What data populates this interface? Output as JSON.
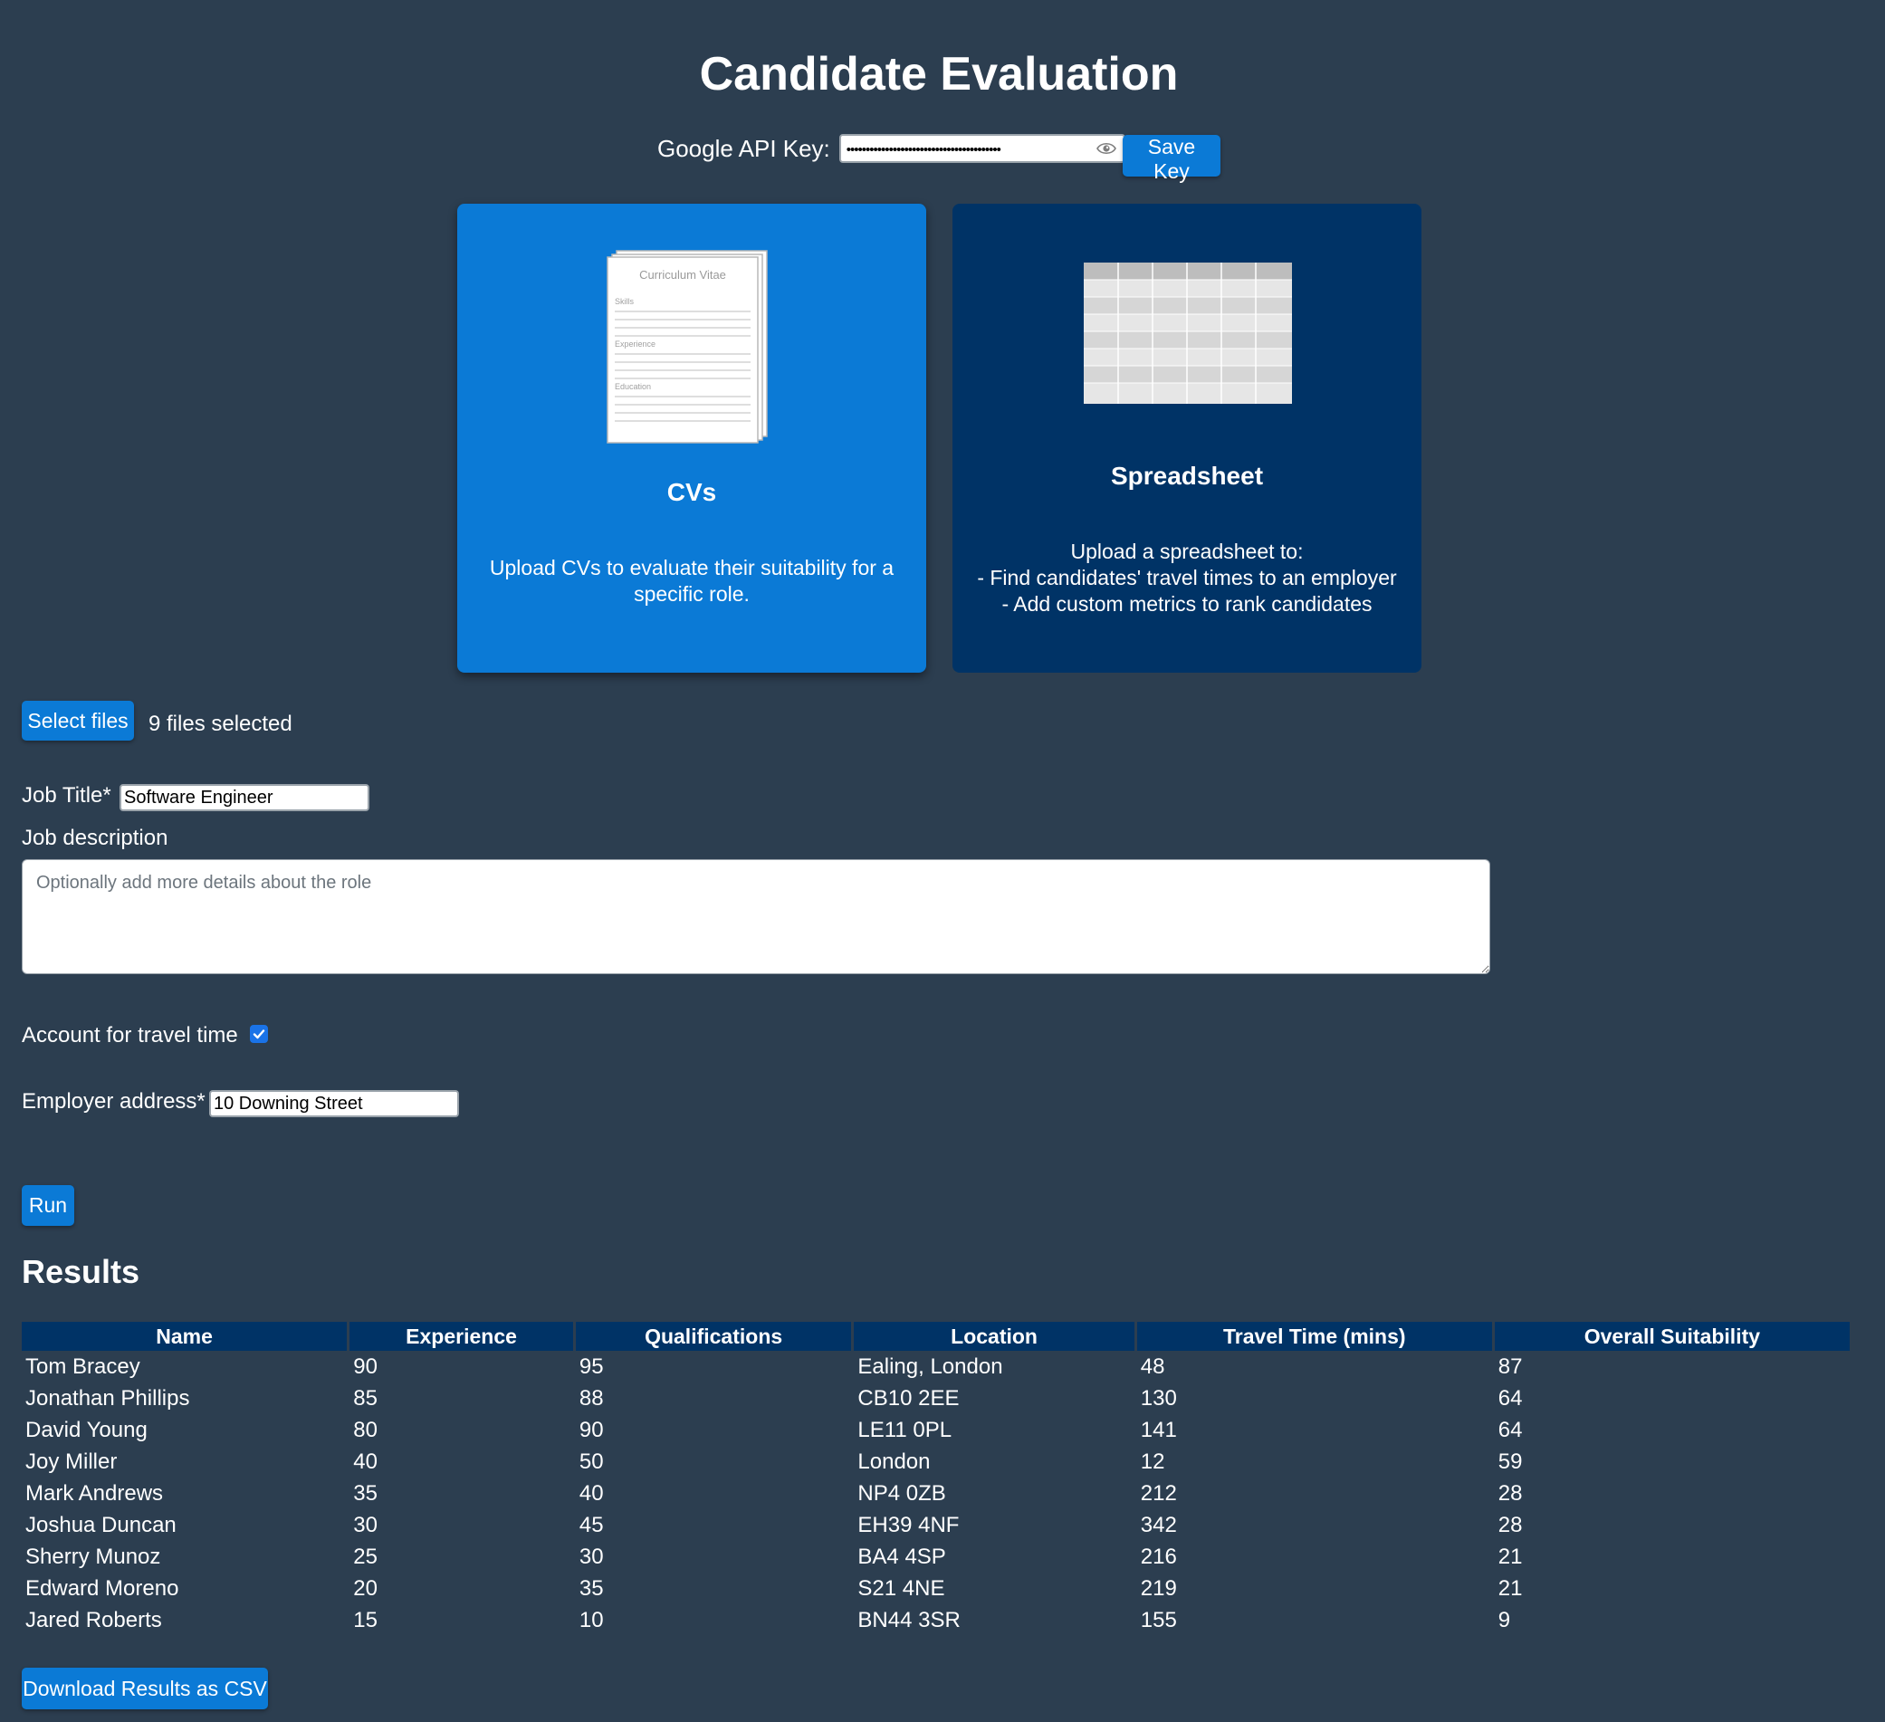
{
  "page": {
    "title": "Candidate Evaluation"
  },
  "api_key": {
    "label": "Google API Key:",
    "masked_value": "••••••••••••••••••••••••••••••••••••••••",
    "save_label": "Save Key",
    "visibility_icon": "eye-icon"
  },
  "cards": {
    "cvs": {
      "title": "CVs",
      "description": "Upload CVs to evaluate their suitability for a specific role.",
      "illustration": {
        "heading": "Curriculum Vitae",
        "sections": [
          "Skills",
          "Experience",
          "Education"
        ]
      },
      "selected": true
    },
    "spreadsheet": {
      "title": "Spreadsheet",
      "description": "Upload a spreadsheet to:\n- Find candidates' travel times to an employer\n- Add custom metrics to rank candidates",
      "selected": false
    }
  },
  "files": {
    "select_label": "Select files",
    "status": "9 files selected"
  },
  "form": {
    "job_title_label": "Job Title*",
    "job_title_value": "Software Engineer",
    "job_description_label": "Job description",
    "job_description_placeholder": "Optionally add more details about the role",
    "travel_time_label": "Account for travel time",
    "travel_time_checked": true,
    "employer_address_label": "Employer address*",
    "employer_address_value": "10 Downing Street",
    "run_label": "Run"
  },
  "results": {
    "heading": "Results",
    "columns": [
      "Name",
      "Experience",
      "Qualifications",
      "Location",
      "Travel Time (mins)",
      "Overall Suitability"
    ],
    "rows": [
      [
        "Tom Bracey",
        "90",
        "95",
        "Ealing, London",
        "48",
        "87"
      ],
      [
        "Jonathan Phillips",
        "85",
        "88",
        "CB10 2EE",
        "130",
        "64"
      ],
      [
        "David Young",
        "80",
        "90",
        "LE11 0PL",
        "141",
        "64"
      ],
      [
        "Joy Miller",
        "40",
        "50",
        "London",
        "12",
        "59"
      ],
      [
        "Mark Andrews",
        "35",
        "40",
        "NP4 0ZB",
        "212",
        "28"
      ],
      [
        "Joshua Duncan",
        "30",
        "45",
        "EH39 4NF",
        "342",
        "28"
      ],
      [
        "Sherry Munoz",
        "25",
        "30",
        "BA4 4SP",
        "216",
        "21"
      ],
      [
        "Edward Moreno",
        "20",
        "35",
        "S21 4NE",
        "219",
        "21"
      ],
      [
        "Jared Roberts",
        "15",
        "10",
        "BN44 3SR",
        "155",
        "9"
      ]
    ],
    "download_label": "Download Results as CSV"
  },
  "colors": {
    "background": "#2c3e50",
    "accent": "#0b7ad6",
    "navy": "#003366",
    "text": "#ffffff"
  }
}
